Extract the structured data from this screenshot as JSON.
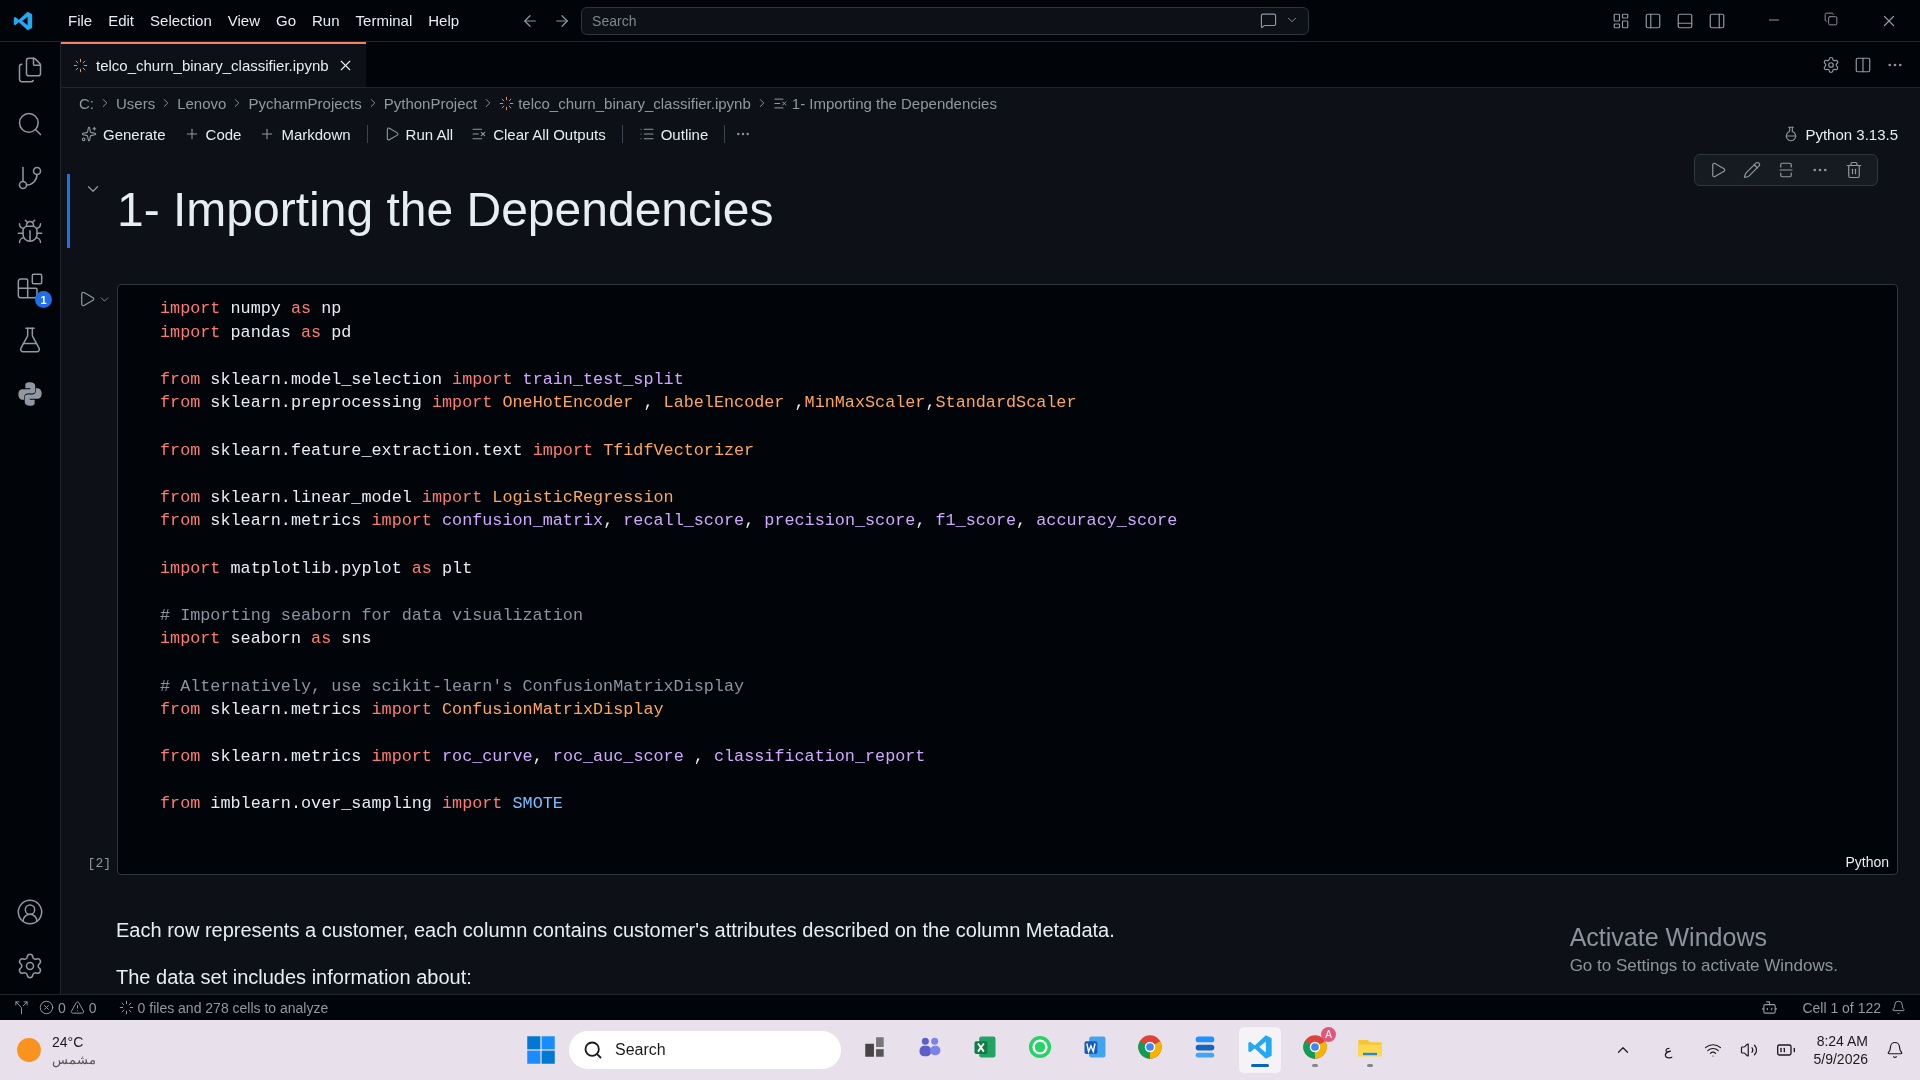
{
  "menu": [
    "File",
    "Edit",
    "Selection",
    "View",
    "Go",
    "Run",
    "Terminal",
    "Help"
  ],
  "search": {
    "placeholder": "Search"
  },
  "tab": {
    "label": "telco_churn_binary_classifier.ipynb",
    "selected": true
  },
  "breadcrumb": [
    "C:",
    "Users",
    "Lenovo",
    "PycharmProjects",
    "PythonProject",
    "telco_churn_binary_classifier.ipynb",
    "1- Importing the Dependencies"
  ],
  "toolbar": [
    "Generate",
    "Code",
    "Markdown",
    "Run All",
    "Clear All Outputs",
    "Outline"
  ],
  "kernel": "Python 3.13.5",
  "extensions_badge": "1",
  "heading": {
    "text": "1- Importing the Dependencies",
    "expanded": true
  },
  "code_cell": {
    "execution_count": "[2]",
    "language": "Python",
    "blocks": [
      [
        [
          {
            "t": "import",
            "kind": "kw"
          },
          {
            "t": " numpy ",
            "kind": "mod"
          },
          {
            "t": "as",
            "kind": "kw"
          },
          {
            "t": " np",
            "kind": "mod"
          }
        ],
        [
          {
            "t": "import",
            "kind": "kw"
          },
          {
            "t": " pandas ",
            "kind": "mod"
          },
          {
            "t": "as",
            "kind": "kw"
          },
          {
            "t": " pd",
            "kind": "mod"
          }
        ]
      ],
      [
        [
          {
            "t": "from",
            "kind": "kw"
          },
          {
            "t": " sklearn.model_selection ",
            "kind": "mod"
          },
          {
            "t": "import",
            "kind": "kw"
          },
          {
            "t": " train_test_split",
            "kind": "fn"
          }
        ],
        [
          {
            "t": "from",
            "kind": "kw"
          },
          {
            "t": " sklearn.preprocessing ",
            "kind": "mod"
          },
          {
            "t": "import",
            "kind": "kw"
          },
          {
            "t": " OneHotEncoder ",
            "kind": "cls"
          },
          {
            "t": ", ",
            "kind": "mod"
          },
          {
            "t": "LabelEncoder ",
            "kind": "cls"
          },
          {
            "t": ",",
            "kind": "mod"
          },
          {
            "t": "MinMaxScaler",
            "kind": "cls"
          },
          {
            "t": ",",
            "kind": "mod"
          },
          {
            "t": "StandardScaler",
            "kind": "cls"
          }
        ]
      ],
      [
        [
          {
            "t": "from",
            "kind": "kw"
          },
          {
            "t": " sklearn.feature_extraction.text ",
            "kind": "mod"
          },
          {
            "t": "import",
            "kind": "kw"
          },
          {
            "t": " TfidfVectorizer",
            "kind": "cls"
          }
        ]
      ],
      [
        [
          {
            "t": "from",
            "kind": "kw"
          },
          {
            "t": " sklearn.linear_model ",
            "kind": "mod"
          },
          {
            "t": "import",
            "kind": "kw"
          },
          {
            "t": " LogisticRegression",
            "kind": "cls"
          }
        ],
        [
          {
            "t": "from",
            "kind": "kw"
          },
          {
            "t": " sklearn.metrics ",
            "kind": "mod"
          },
          {
            "t": "import",
            "kind": "kw"
          },
          {
            "t": " confusion_matrix",
            "kind": "fn"
          },
          {
            "t": ", ",
            "kind": "mod"
          },
          {
            "t": "recall_score",
            "kind": "fn"
          },
          {
            "t": ", ",
            "kind": "mod"
          },
          {
            "t": "precision_score",
            "kind": "fn"
          },
          {
            "t": ", ",
            "kind": "mod"
          },
          {
            "t": "f1_score",
            "kind": "fn"
          },
          {
            "t": ", ",
            "kind": "mod"
          },
          {
            "t": "accuracy_score",
            "kind": "fn"
          }
        ]
      ],
      [
        [
          {
            "t": "import",
            "kind": "kw"
          },
          {
            "t": " matplotlib.pyplot ",
            "kind": "mod"
          },
          {
            "t": "as",
            "kind": "kw"
          },
          {
            "t": " plt",
            "kind": "mod"
          }
        ]
      ],
      [
        [
          {
            "t": "# Importing seaborn for data visualization",
            "kind": "comment"
          }
        ],
        [
          {
            "t": "import",
            "kind": "kw"
          },
          {
            "t": " seaborn ",
            "kind": "mod"
          },
          {
            "t": "as",
            "kind": "kw"
          },
          {
            "t": " sns",
            "kind": "mod"
          }
        ]
      ],
      [
        [
          {
            "t": "# Alternatively, use scikit-learn's ConfusionMatrixDisplay",
            "kind": "comment"
          }
        ],
        [
          {
            "t": "from",
            "kind": "kw"
          },
          {
            "t": " sklearn.metrics ",
            "kind": "mod"
          },
          {
            "t": "import",
            "kind": "kw"
          },
          {
            "t": " ConfusionMatrixDisplay",
            "kind": "cls"
          }
        ]
      ],
      [
        [
          {
            "t": "from",
            "kind": "kw"
          },
          {
            "t": " sklearn.metrics ",
            "kind": "mod"
          },
          {
            "t": "import",
            "kind": "kw"
          },
          {
            "t": " roc_curve",
            "kind": "fn"
          },
          {
            "t": ", ",
            "kind": "mod"
          },
          {
            "t": "roc_auc_score",
            "kind": "fn"
          },
          {
            "t": " , ",
            "kind": "mod"
          },
          {
            "t": "classification_report",
            "kind": "fn"
          }
        ]
      ],
      [
        [
          {
            "t": "from",
            "kind": "kw"
          },
          {
            "t": " imblearn.over_sampling ",
            "kind": "mod"
          },
          {
            "t": "import",
            "kind": "kw"
          },
          {
            "t": " SMOTE",
            "kind": "const"
          }
        ]
      ]
    ]
  },
  "markdown": [
    "Each row represents a customer, each column contains customer's attributes described on the column Metadata.",
    "The data set includes information about:"
  ],
  "activation": {
    "title": "Activate Windows",
    "subtitle": "Go to Settings to activate Windows."
  },
  "status_bar": {
    "errors": "0",
    "warnings": "0",
    "analysis": "0 files and 278 cells to analyze",
    "cell_position": "Cell 1 of 122"
  },
  "taskbar": {
    "temperature": "24°C",
    "weather": "مشمس",
    "search_placeholder": "Search",
    "apps": [
      {
        "running": false,
        "active": false
      },
      {
        "running": false,
        "active": false
      },
      {
        "running": false,
        "active": false
      },
      {
        "running": false,
        "active": false
      },
      {
        "running": false,
        "active": false
      },
      {
        "running": false,
        "active": false
      },
      {
        "running": false,
        "active": false
      },
      {
        "running": true,
        "active": true
      },
      {
        "running": true,
        "active": false,
        "badge": "A"
      },
      {
        "running": true,
        "active": false
      }
    ],
    "language": "ع",
    "time": "8:24 AM",
    "date": "5/9/2026"
  }
}
